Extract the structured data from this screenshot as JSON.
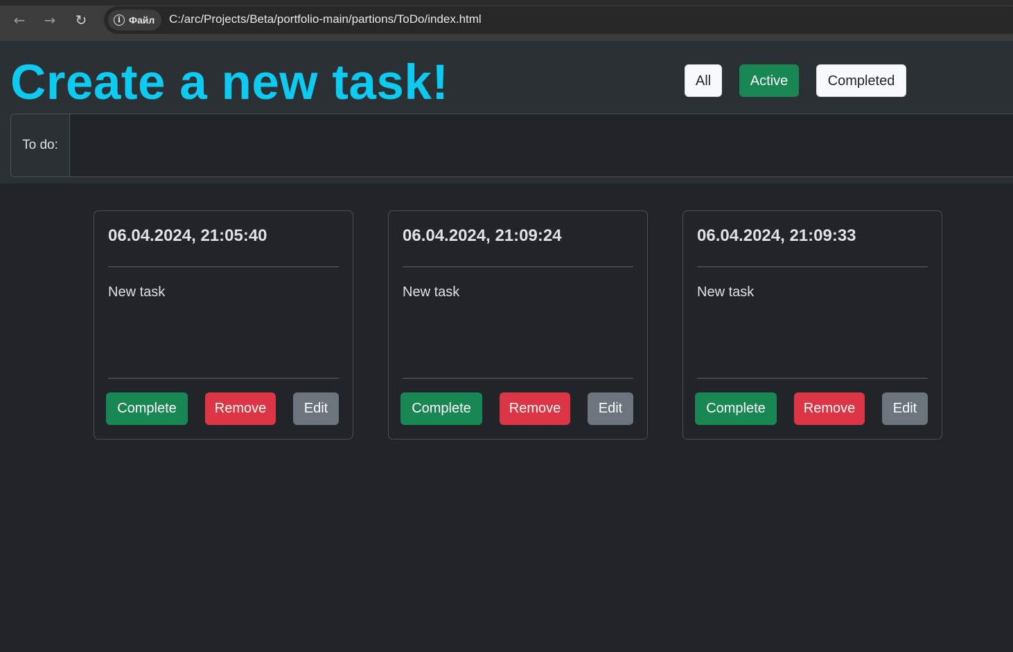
{
  "browser": {
    "back_icon": "arrow-left-icon",
    "forward_icon": "arrow-right-icon",
    "reload_icon": "reload-icon",
    "chip_label": "Файл",
    "url": "C:/arc/Projects/Beta/portfolio-main/partions/ToDo/index.html"
  },
  "header": {
    "title": "Create a new task!",
    "filters": [
      {
        "label": "All",
        "selected": false
      },
      {
        "label": "Active",
        "selected": true
      },
      {
        "label": "Completed",
        "selected": false
      }
    ],
    "input_label": "To do:",
    "input_value": ""
  },
  "tasks": [
    {
      "date": "06.04.2024, 21:05:40",
      "text": "New task",
      "complete_label": "Complete",
      "remove_label": "Remove",
      "edit_label": "Edit"
    },
    {
      "date": "06.04.2024, 21:09:24",
      "text": "New task",
      "complete_label": "Complete",
      "remove_label": "Remove",
      "edit_label": "Edit"
    },
    {
      "date": "06.04.2024, 21:09:33",
      "text": "New task",
      "complete_label": "Complete",
      "remove_label": "Remove",
      "edit_label": "Edit"
    }
  ],
  "colors": {
    "background": "#212529",
    "header_bg": "#2b3035",
    "title": "#0dcaf0",
    "success": "#198754",
    "danger": "#dc3545",
    "secondary": "#6c757d"
  }
}
